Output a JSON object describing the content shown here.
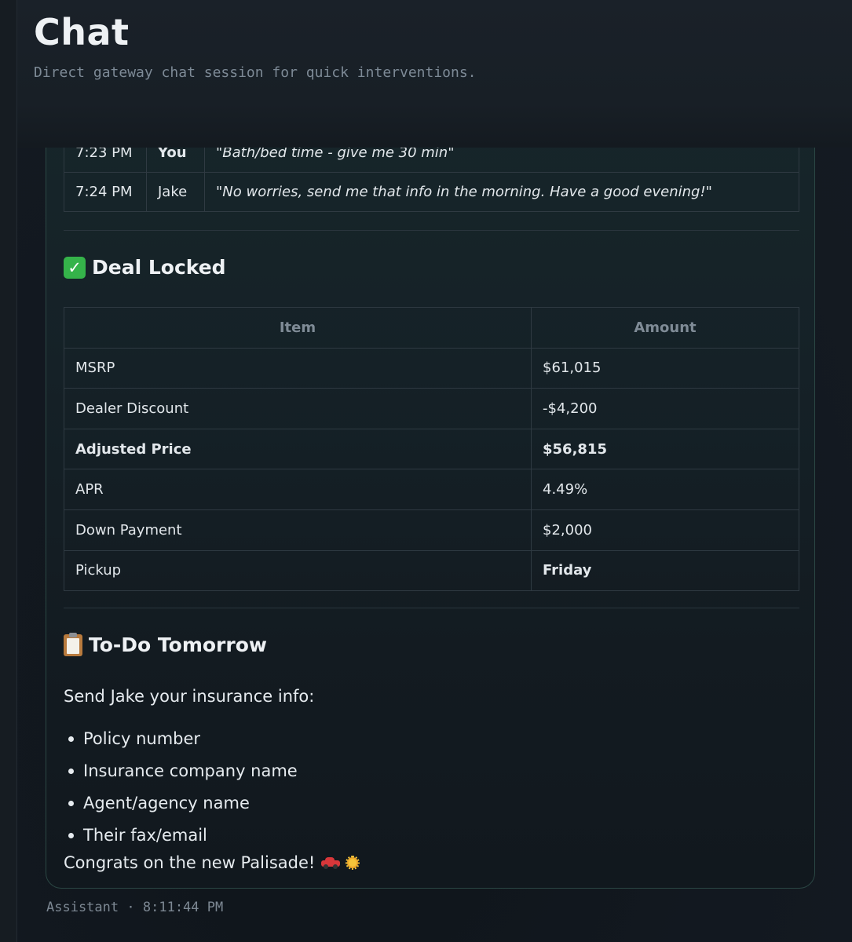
{
  "header": {
    "title": "Chat",
    "subtitle": "Direct gateway chat session for quick interventions."
  },
  "message": {
    "timeline": [
      {
        "time": "7:23 PM",
        "who": "You",
        "text": "\"Bath/bed time - give me 30 min\""
      },
      {
        "time": "7:24 PM",
        "who": "Jake",
        "text": "\"No worries, send me that info in the morning. Have a good evening!\""
      }
    ],
    "deal": {
      "heading": "Deal Locked",
      "icon": "check-mark-icon",
      "columns": [
        "Item",
        "Amount"
      ],
      "rows": [
        {
          "item": "MSRP",
          "amount": "$61,015",
          "bold_item": false,
          "bold_amount": false
        },
        {
          "item": "Dealer Discount",
          "amount": "-$4,200",
          "bold_item": false,
          "bold_amount": false
        },
        {
          "item": "Adjusted Price",
          "amount": "$56,815",
          "bold_item": true,
          "bold_amount": true
        },
        {
          "item": "APR",
          "amount": "4.49%",
          "bold_item": false,
          "bold_amount": false
        },
        {
          "item": "Down Payment",
          "amount": "$2,000",
          "bold_item": false,
          "bold_amount": false
        },
        {
          "item": "Pickup",
          "amount": "Friday",
          "bold_item": false,
          "bold_amount": true
        }
      ]
    },
    "todo": {
      "heading": "To-Do Tomorrow",
      "icon": "clipboard-icon",
      "intro": "Send Jake your insurance info:",
      "items": [
        "Policy number",
        "Insurance company name",
        "Agent/agency name",
        "Their fax/email"
      ],
      "closing": "Congrats on the new Palisade!",
      "closing_icons": [
        "car-icon",
        "sun-icon"
      ]
    },
    "meta": {
      "sender": "Assistant",
      "separator": "·",
      "time": "8:11:44 PM"
    }
  },
  "colors": {
    "background": "#12171c",
    "card_border": "#2b4744",
    "check_green": "#35b34a",
    "muted_text": "#7d8a96"
  }
}
